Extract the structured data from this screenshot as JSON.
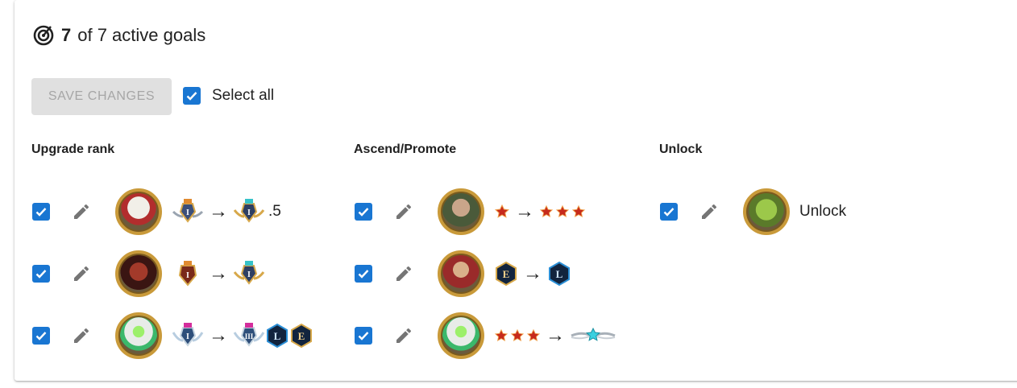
{
  "header": {
    "active_count": "7",
    "summary_text": "of 7 active goals"
  },
  "toolbar": {
    "save_label": "SAVE CHANGES",
    "select_all_label": "Select all",
    "select_all_checked": true
  },
  "columns": {
    "upgrade_rank": {
      "title": "Upgrade rank",
      "rows": [
        {
          "checked": true,
          "suffix": ".5"
        },
        {
          "checked": true,
          "suffix": ""
        },
        {
          "checked": true,
          "suffix": ""
        }
      ]
    },
    "ascend_promote": {
      "title": "Ascend/Promote",
      "rows": [
        {
          "checked": true
        },
        {
          "checked": true
        },
        {
          "checked": true
        }
      ]
    },
    "unlock": {
      "title": "Unlock",
      "rows": [
        {
          "checked": true,
          "label": "Unlock"
        }
      ]
    }
  },
  "colors": {
    "accent": "#1976d2",
    "disabled_bg": "#e0e0e0",
    "disabled_text": "#a6a6a6",
    "icon_gray": "#757575"
  }
}
